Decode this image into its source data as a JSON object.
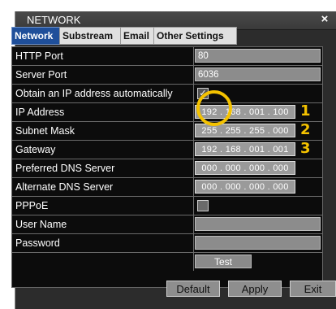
{
  "window": {
    "title": "NETWORK",
    "close_glyph": "×"
  },
  "tabs": [
    {
      "label": "Network",
      "active": true
    },
    {
      "label": "Substream",
      "active": false
    },
    {
      "label": "Email",
      "active": false
    },
    {
      "label": "Other Settings",
      "active": false
    }
  ],
  "fields": {
    "http_port": {
      "label": "HTTP Port",
      "value": "80"
    },
    "server_port": {
      "label": "Server Port",
      "value": "6036"
    },
    "dhcp": {
      "label": "Obtain an IP address automatically",
      "checked": true,
      "check_glyph": "✓"
    },
    "ip_address": {
      "label": "IP Address",
      "value": "192 . 168 . 001 . 100"
    },
    "subnet_mask": {
      "label": "Subnet Mask",
      "value": "255 . 255 . 255 . 000"
    },
    "gateway": {
      "label": "Gateway",
      "value": "192 . 168 . 001 . 001"
    },
    "preferred_dns": {
      "label": "Preferred DNS Server",
      "value": "000 . 000 . 000 . 000"
    },
    "alternate_dns": {
      "label": "Alternate DNS Server",
      "value": "000 . 000 . 000 . 000"
    },
    "pppoe": {
      "label": "PPPoE",
      "checked": false
    },
    "user_name": {
      "label": "User Name",
      "value": ""
    },
    "password": {
      "label": "Password",
      "value": ""
    }
  },
  "annotations": {
    "one": "1",
    "two": "2",
    "three": "3",
    "highlight_color": "#f4c200"
  },
  "buttons": {
    "test": "Test",
    "default": "Default",
    "apply": "Apply",
    "exit": "Exit"
  },
  "colors": {
    "active_tab": "#1f4f9a",
    "panel_bg": "#0c0c0c",
    "dialog_bg": "#2c2c2c"
  }
}
